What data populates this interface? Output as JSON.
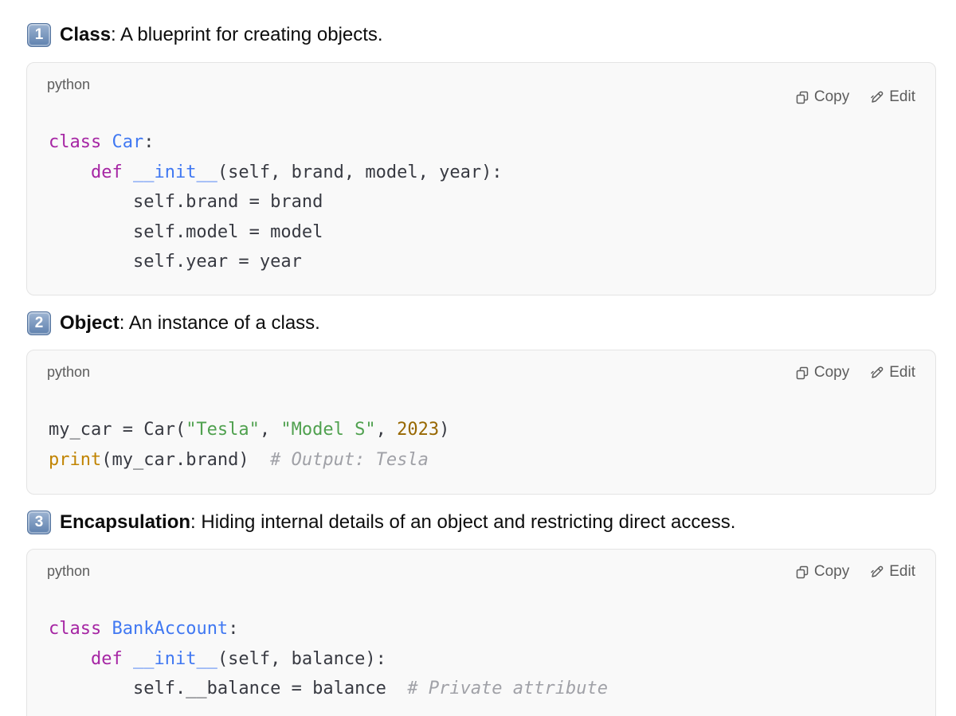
{
  "sections": [
    {
      "number": "1",
      "term": "Class",
      "description": ": A blueprint for creating objects.",
      "language": "python",
      "copy_label": "Copy",
      "edit_label": "Edit",
      "code": [
        [
          [
            "kw",
            "class "
          ],
          [
            "cls",
            "Car"
          ],
          [
            "p",
            ":"
          ]
        ],
        [
          [
            "p",
            "    "
          ],
          [
            "kw",
            "def "
          ],
          [
            "cls",
            "__init__"
          ],
          [
            "p",
            "(self, brand, model, year):"
          ]
        ],
        [
          [
            "p",
            "        self.brand = brand"
          ]
        ],
        [
          [
            "p",
            "        self.model = model"
          ]
        ],
        [
          [
            "p",
            "        self.year = year"
          ]
        ]
      ]
    },
    {
      "number": "2",
      "term": "Object",
      "description": ": An instance of a class.",
      "language": "python",
      "copy_label": "Copy",
      "edit_label": "Edit",
      "code": [
        [
          [
            "p",
            "my_car = Car("
          ],
          [
            "str",
            "\"Tesla\""
          ],
          [
            "p",
            ", "
          ],
          [
            "str",
            "\"Model S\""
          ],
          [
            "p",
            ", "
          ],
          [
            "num",
            "2023"
          ],
          [
            "p",
            ")"
          ]
        ],
        [
          [
            "bi",
            "print"
          ],
          [
            "p",
            "(my_car.brand)  "
          ],
          [
            "cm",
            "# Output: Tesla"
          ]
        ]
      ]
    },
    {
      "number": "3",
      "term": "Encapsulation",
      "description": ": Hiding internal details of an object and restricting direct access.",
      "language": "python",
      "copy_label": "Copy",
      "edit_label": "Edit",
      "code": [
        [
          [
            "kw",
            "class "
          ],
          [
            "cls",
            "BankAccount"
          ],
          [
            "p",
            ":"
          ]
        ],
        [
          [
            "p",
            "    "
          ],
          [
            "kw",
            "def "
          ],
          [
            "cls",
            "__init__"
          ],
          [
            "p",
            "(self, balance):"
          ]
        ],
        [
          [
            "p",
            "        self.__balance = balance  "
          ],
          [
            "cm",
            "# Private attribute"
          ]
        ]
      ]
    }
  ]
}
